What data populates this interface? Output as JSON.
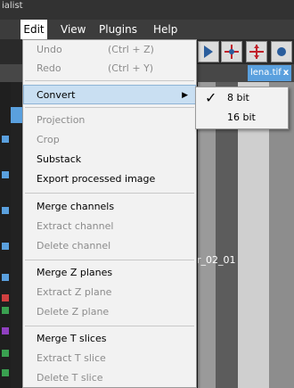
{
  "window": {
    "title": "ialist"
  },
  "menubar": [
    {
      "label": "Edit"
    },
    {
      "label": "View"
    },
    {
      "label": "Plugins"
    },
    {
      "label": "Help"
    }
  ],
  "tab": {
    "label": "lena.tif",
    "close": "x"
  },
  "image_label": "0r_02_01",
  "edit_menu": {
    "undo": {
      "label": "Undo",
      "shortcut": "(Ctrl + Z)"
    },
    "redo": {
      "label": "Redo",
      "shortcut": "(Ctrl + Y)"
    },
    "convert": {
      "label": "Convert",
      "arrow": "▶"
    },
    "projection": "Projection",
    "crop": "Crop",
    "substack": "Substack",
    "export_processed": "Export processed image",
    "merge_channels": "Merge channels",
    "extract_channel": "Extract channel",
    "delete_channel": "Delete channel",
    "merge_z": "Merge Z planes",
    "extract_z": "Extract Z plane",
    "delete_z": "Delete Z plane",
    "merge_t": "Merge T slices",
    "extract_t": "Extract T slice",
    "delete_t": "Delete T slice"
  },
  "convert_submenu": {
    "check": "✓",
    "bit8": "8 bit",
    "bit16": "16 bit"
  },
  "colors": {
    "menu_bg": "#f2f2f2",
    "highlight": "#c9dff2",
    "accent": "#5aa0de",
    "disabled_text": "#8c8c8c"
  }
}
